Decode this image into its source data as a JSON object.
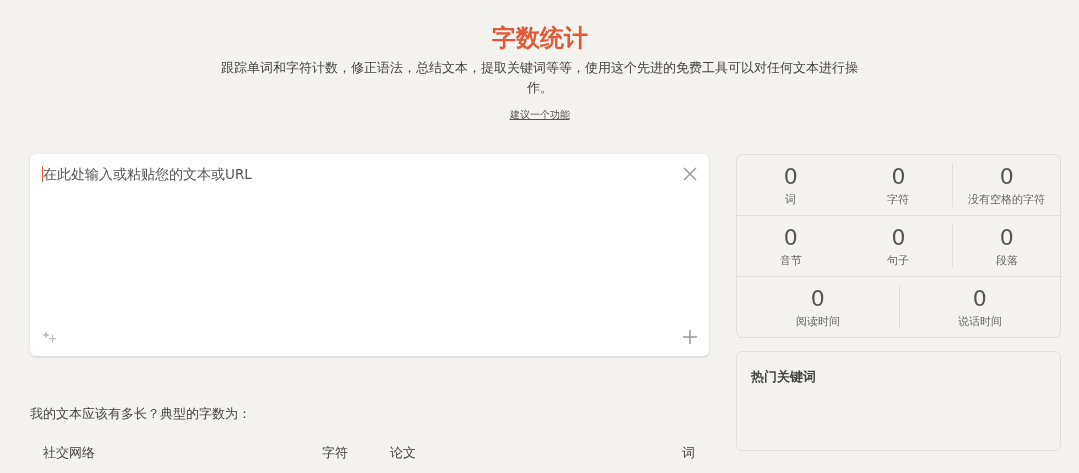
{
  "header": {
    "title": "字数统计",
    "subtitle": "跟踪单词和字符计数，修正语法，总结文本，提取关键词等等，使用这个先进的免费工具可以对任何文本进行操作。",
    "link": "建议一个功能"
  },
  "editor": {
    "placeholder": "在此处输入或粘贴您的文本或URL"
  },
  "stats": [
    {
      "value": "0",
      "label": "词"
    },
    {
      "value": "0",
      "label": "字符"
    },
    {
      "value": "0",
      "label": "没有空格的字符"
    },
    {
      "value": "0",
      "label": "音节"
    },
    {
      "value": "0",
      "label": "句子"
    },
    {
      "value": "0",
      "label": "段落"
    },
    {
      "value": "0",
      "label": "阅读时间"
    },
    {
      "value": "0",
      "label": "说话时间"
    }
  ],
  "keywords": {
    "title": "热门关键词"
  },
  "lengths": {
    "question": "我的文本应该有多长？典型的字数为：",
    "rows": [
      [
        "社交网络",
        "字符",
        "论文",
        "词"
      ]
    ]
  }
}
